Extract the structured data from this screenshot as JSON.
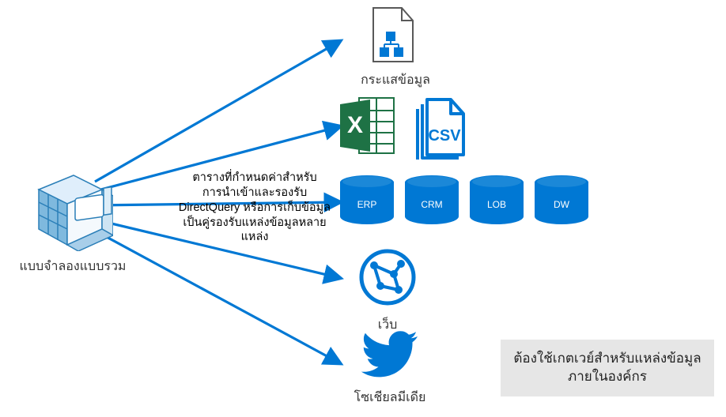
{
  "model": {
    "label": "แบบจำลองแบบรวม"
  },
  "dataflow": {
    "label": "กระแสข้อมูล"
  },
  "files": {
    "csv_label": "CSV"
  },
  "annotation": "ตารางที่กำหนดค่าสำหรับการนำเข้าและรองรับ DirectQuery หรือการเก็บข้อมูลเป็นคู่รองรับแหล่งข้อมูลหลายแหล่ง",
  "dbs": [
    "ERP",
    "CRM",
    "LOB",
    "DW"
  ],
  "web": {
    "label": "เว็บ"
  },
  "social": {
    "label": "โซเชียลมีเดีย"
  },
  "gateway_note": "ต้องใช้เกตเวย์สำหรับแหล่งข้อมูลภายในองค์กร"
}
